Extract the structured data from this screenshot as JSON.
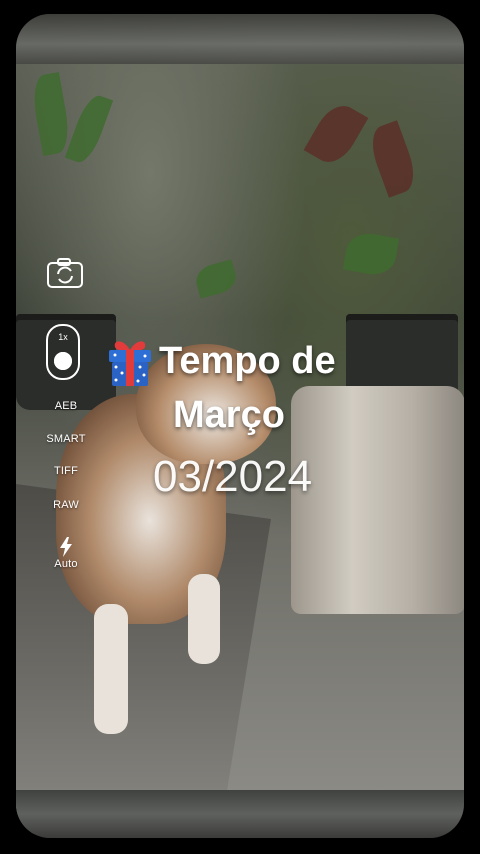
{
  "camera": {
    "zoom_label": "1x",
    "options": [
      "AEB",
      "SMART",
      "TIFF",
      "RAW"
    ],
    "flash_label": "Auto",
    "icons": {
      "switch_camera": "camera-switch-icon",
      "zoom": "zoom-lens-icon",
      "flash": "flash-icon"
    }
  },
  "overlay": {
    "emoji_icon": "gift-icon",
    "title_line1": "Tempo de",
    "title_line2": "Março",
    "date": "03/2024"
  }
}
